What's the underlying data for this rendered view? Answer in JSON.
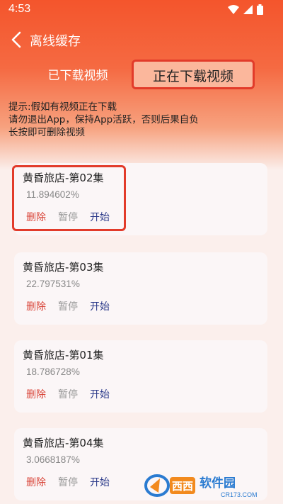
{
  "status": {
    "time": "4:53"
  },
  "header": {
    "title": "离线缓存"
  },
  "tabs": {
    "downloaded": "已下载视频",
    "downloading": "正在下载视频"
  },
  "tips": {
    "line1": "提示:假如有视频正在下载",
    "line2": "请勿退出App，保持App活跃，否则后果自负",
    "line3": "长按即可删除视频"
  },
  "items": [
    {
      "name": "黄昏旅店-第02集",
      "progress": "11.894602%",
      "delete": "删除",
      "pause": "暂停",
      "start": "开始"
    },
    {
      "name": "黄昏旅店-第03集",
      "progress": "22.797531%",
      "delete": "删除",
      "pause": "暂停",
      "start": "开始"
    },
    {
      "name": "黄昏旅店-第01集",
      "progress": "18.786728%",
      "delete": "删除",
      "pause": "暂停",
      "start": "开始"
    },
    {
      "name": "黄昏旅店-第04集",
      "progress": "3.0668187%",
      "delete": "删除",
      "pause": "暂停",
      "start": "开始"
    }
  ],
  "watermark": {
    "brand": "西西软件园",
    "domain": "CR173.COM"
  },
  "colors": {
    "accent": "#f4552c",
    "highlight": "#e23b2a",
    "delete": "#d9463a",
    "start": "#2b3a8a"
  }
}
